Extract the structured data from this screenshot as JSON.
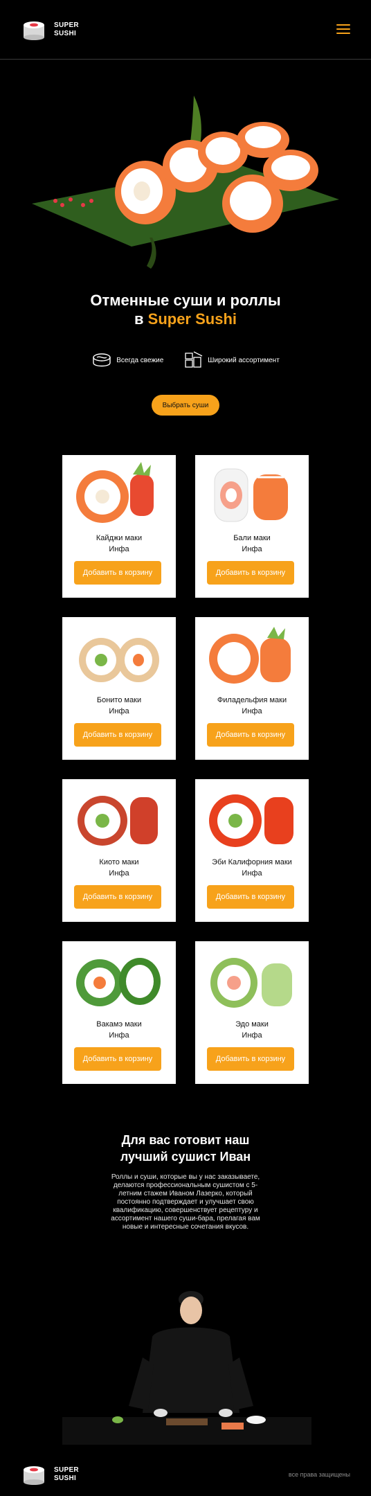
{
  "header": {
    "logo_line1": "SUPER",
    "logo_line2": "SUSHI"
  },
  "hero": {
    "title_line1": "Отменные суши и роллы",
    "title_prefix": "в",
    "title_accent": "Super Sushi",
    "features": [
      {
        "icon": "roll-icon",
        "label": "Всегда свежие"
      },
      {
        "icon": "sushi-set-icon",
        "label": "Широкий ассортимент"
      }
    ],
    "cta_label": "Выбрать суши"
  },
  "products": [
    {
      "name": "Кайджи маки",
      "info": "Инфа",
      "button": "Добавить в корзину"
    },
    {
      "name": "Бали маки",
      "info": "Инфа",
      "button": "Добавить в корзину"
    },
    {
      "name": "Бонито маки",
      "info": "Инфа",
      "button": "Добавить в корзину"
    },
    {
      "name": "Филадельфия маки",
      "info": "Инфа",
      "button": "Добавить в корзину"
    },
    {
      "name": "Киото маки",
      "info": "Инфа",
      "button": "Добавить в корзину"
    },
    {
      "name": "Эби Калифорния маки",
      "info": "Инфа",
      "button": "Добавить в корзину"
    },
    {
      "name": "Вакамэ маки",
      "info": "Инфа",
      "button": "Добавить в корзину"
    },
    {
      "name": "Эдо маки",
      "info": "Инфа",
      "button": "Добавить в корзину"
    }
  ],
  "chef": {
    "title_line1": "Для вас готовит наш",
    "title_line2": "лучший сушист Иван",
    "text": "Роллы и суши, которые вы у нас заказываете, делаются профессиональным сушистом с 5-летним стажем Иваном Лазерко, который постоянно подтверждает и улучшает свою квалификацию, совершенствует рецептуру и ассортимент нашего суши-бара, прелагая вам новые и интересные сочетания вкусов."
  },
  "footer": {
    "logo_line1": "SUPER",
    "logo_line2": "SUSHI",
    "rights": "все права защищены"
  },
  "colors": {
    "accent": "#f7a21b",
    "background": "#000000",
    "card": "#ffffff"
  }
}
